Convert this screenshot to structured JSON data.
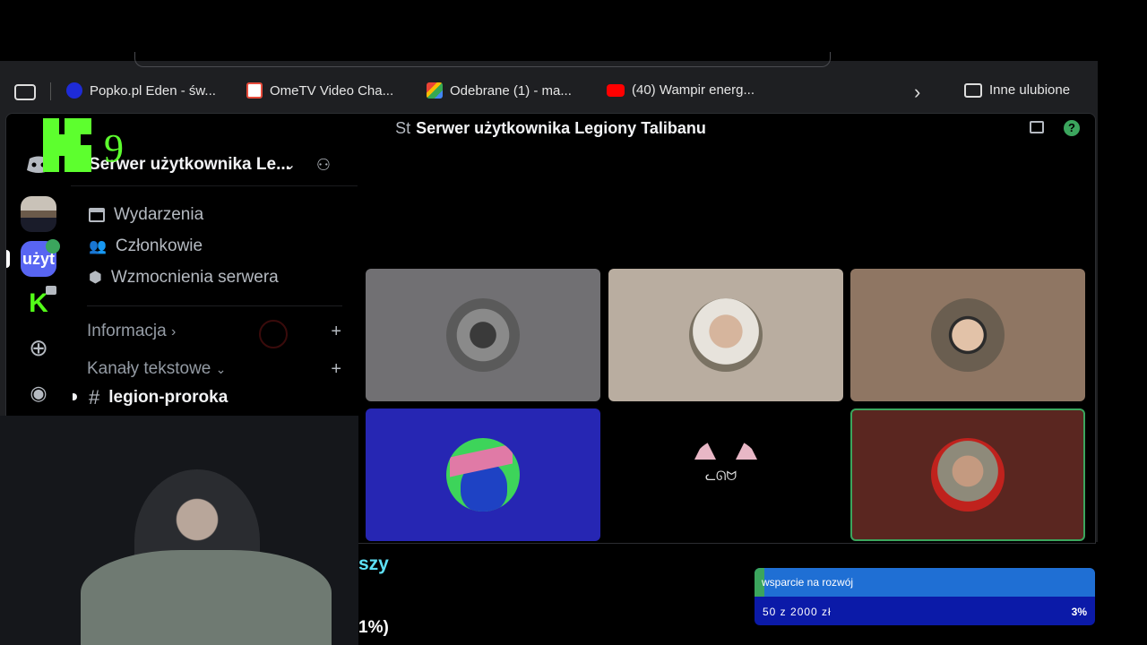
{
  "browser": {
    "bookmarks": [
      {
        "label": "Popko.pl Eden - św...",
        "icon": "popko-icon"
      },
      {
        "label": "OmeTV Video Cha...",
        "icon": "ometv-icon"
      },
      {
        "label": "Odebrane (1) - ma...",
        "icon": "gmail-icon"
      },
      {
        "label": "(40) Wampir energ...",
        "icon": "youtube-icon"
      }
    ],
    "other_bookmarks": "Inne ulubione"
  },
  "discord": {
    "window_title": "Serwer użytkownika Legiony Talibanu",
    "window_title_prefix": "St",
    "server_name": "Serwer użytkownika Le...",
    "guild_label": "użyt",
    "menu": {
      "events": "Wydarzenia",
      "members": "Członkowie",
      "boosts": "Wzmocnienia serwera"
    },
    "categories": {
      "info": "Informacja",
      "info_chevron": "›",
      "text": "Kanały tekstowe",
      "text_chevron": "⌄"
    },
    "active_channel": "legion-proroka",
    "cat_label": "ᓚᘏᗢ"
  },
  "overlay": {
    "logo_number": "9",
    "text_szy": "szy",
    "text_pct": "1%)"
  },
  "donation": {
    "title": "wsparcie na rozwój",
    "amount": "50 z 2000 zł",
    "percent": "3%",
    "progress": 0.03
  },
  "colors": {
    "accent_green": "#3ba55d",
    "donation_blue": "#1f6fd4",
    "donation_dark": "#0b1aa8",
    "logo_green": "#5dff2e"
  }
}
